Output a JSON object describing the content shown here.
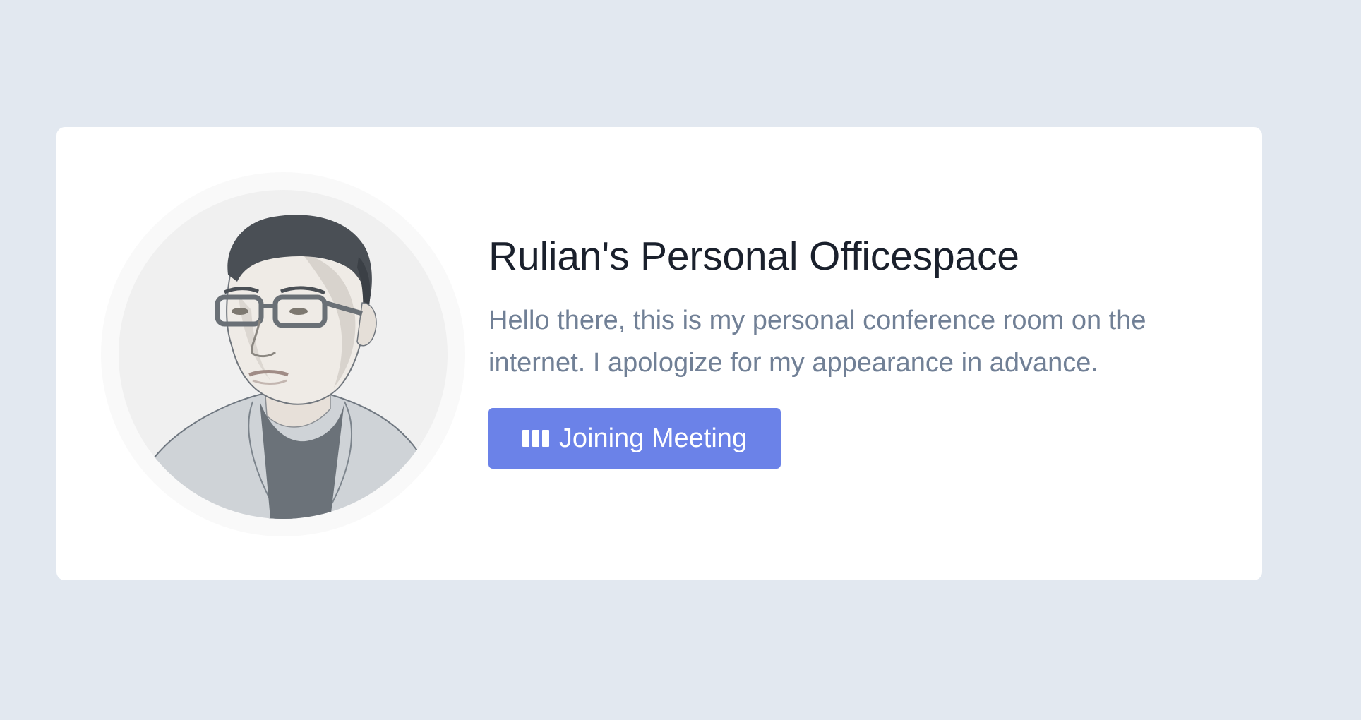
{
  "colors": {
    "page_background": "#e2e8f0",
    "card_background": "#ffffff",
    "title_text": "#1a202c",
    "description_text": "#718096",
    "button_background": "#6b82e8",
    "button_text": "#ffffff"
  },
  "profile": {
    "avatar_icon": "person-portrait-illustration"
  },
  "header": {
    "title": "Rulian's Personal Officespace"
  },
  "main": {
    "description": "Hello there, this is my personal conference room on the internet. I apologize for my appearance in advance."
  },
  "actions": {
    "join_icon": "loading-bars-icon",
    "join_label": "Joining Meeting"
  }
}
